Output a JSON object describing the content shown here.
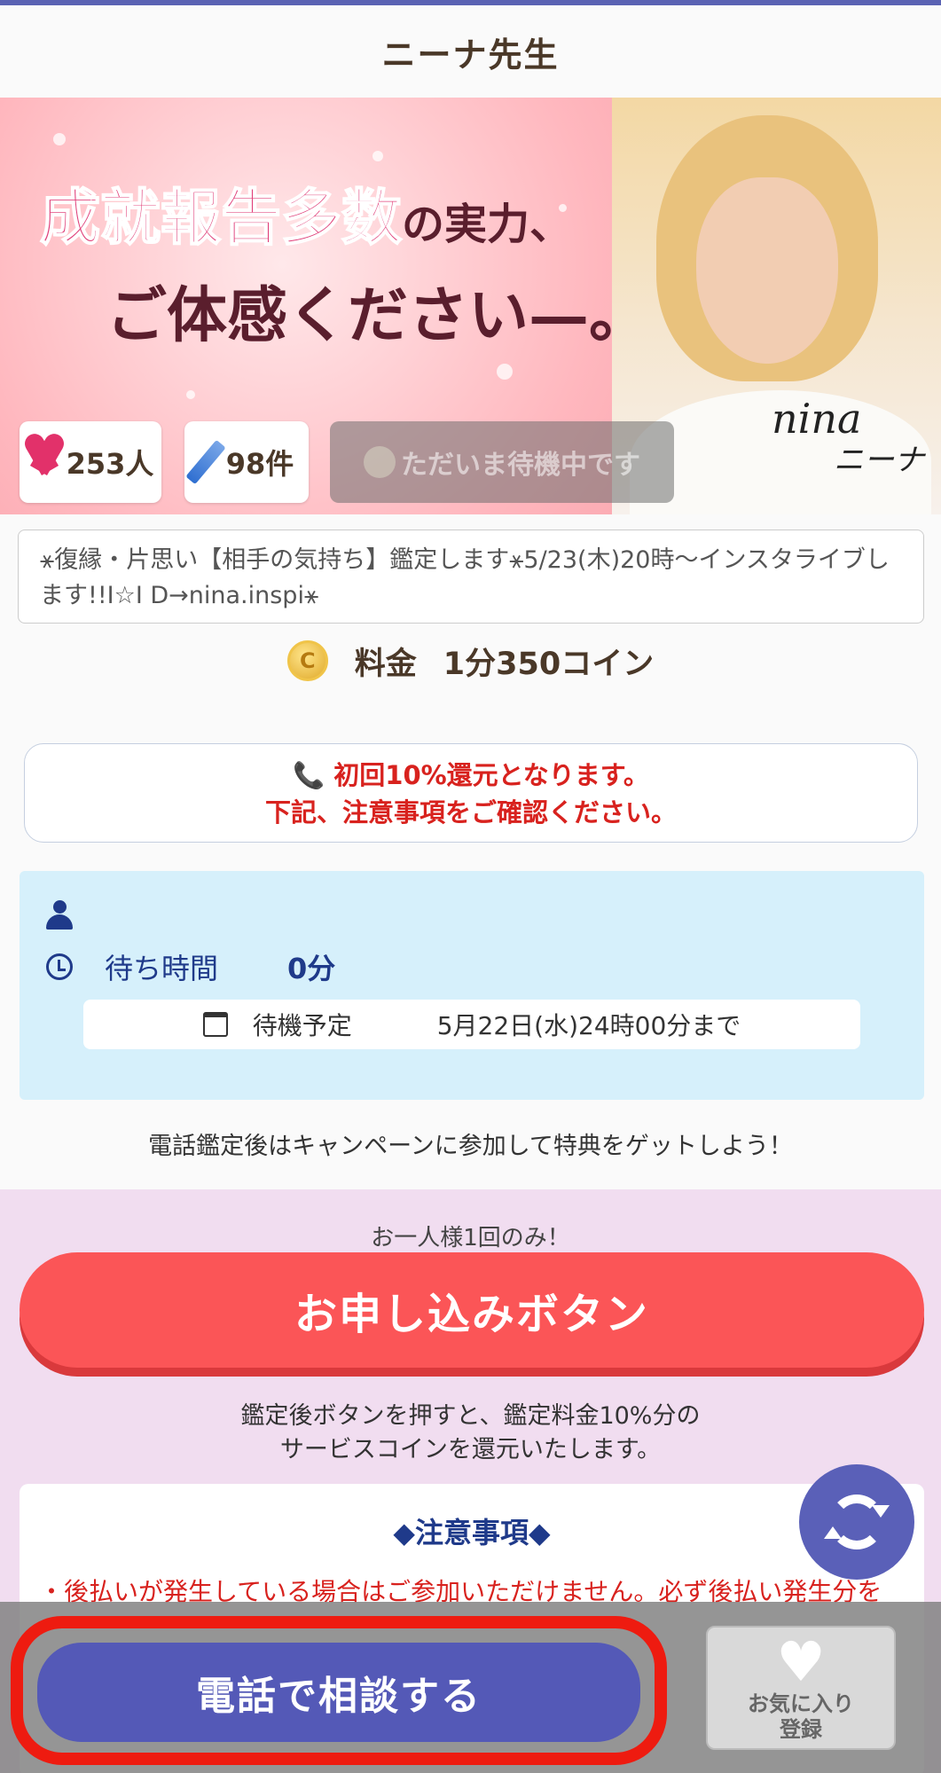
{
  "header": {
    "title": "ニーナ先生"
  },
  "banner": {
    "headline_pink": "成就報告多数",
    "headline_suffix": "の実力、",
    "headline_line2": "ご体感ください—。",
    "signature_en": "nina",
    "signature_jp": "ニーナ"
  },
  "stats": {
    "likes": "253人",
    "reviews": "98件",
    "status": "ただいま待機中です"
  },
  "description": "⚹復縁・片思い【相手の気持ち】鑑定します⚹5/23(木)20時〜インスタライブします!!I☆I D→nina.inspi⚹",
  "fee": {
    "coin_symbol": "C",
    "label": "料金",
    "value": "1分350コイン"
  },
  "notice": {
    "line1": "📞 初回10%還元となります。",
    "line2": "下記、注意事項をご確認ください。"
  },
  "wait": {
    "label": "待ち時間",
    "value": "0分",
    "schedule_label": "待機予定",
    "schedule_value": "5月22日(水)24時00分まで"
  },
  "campaign_note": "電話鑑定後はキャンペーンに参加して特典をゲットしよう！",
  "apply": {
    "once_label": "お一人様1回のみ！",
    "button_label": "お申し込みボタン",
    "note_line1": "鑑定後ボタンを押すと、鑑定料金10%分の",
    "note_line2": "サービスコインを還元いたします。"
  },
  "caution": {
    "title": "◆注意事項◆",
    "item1": "・後払いが発生している場合はご参加いただけません。必ず後払い発生分を"
  },
  "bottom_bar": {
    "call_button": "電話で相談する",
    "favorite_line1": "お気に入り",
    "favorite_line2": "登録",
    "favorite_icon": "heart-icon"
  },
  "colors": {
    "accent": "#5459b7",
    "apply_red": "#fb5557",
    "highlight": "#ee1b10",
    "wait_panel_bg": "#d6f0fb",
    "pink_bg": "#f1ddf0"
  }
}
